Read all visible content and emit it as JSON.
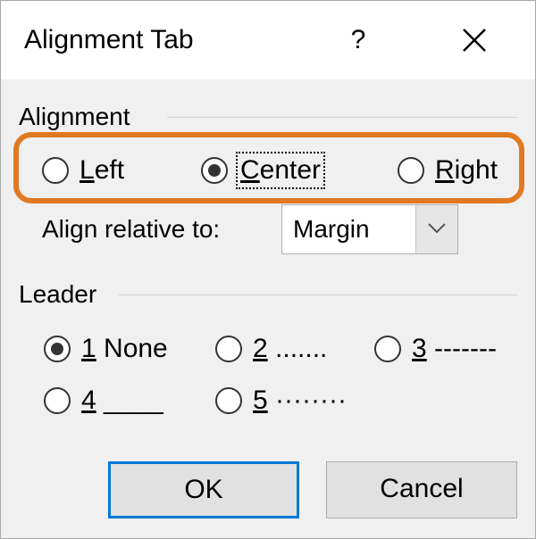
{
  "dialog": {
    "title": "Alignment Tab",
    "help_label": "?"
  },
  "alignment": {
    "group_label": "Alignment",
    "options": [
      {
        "mnemonic": "L",
        "rest": "eft",
        "checked": false
      },
      {
        "mnemonic": "C",
        "rest": "enter",
        "checked": true
      },
      {
        "mnemonic": "R",
        "rest": "ight",
        "checked": false
      }
    ],
    "relative_label": "Align relative to:",
    "relative_value": "Margin",
    "highlight_color": "#e07a22"
  },
  "leader": {
    "group_label": "Leader",
    "options": [
      {
        "mnemonic": "1",
        "rest": " None",
        "checked": true
      },
      {
        "mnemonic": "2",
        "rest": " .......",
        "checked": false
      },
      {
        "mnemonic": "3",
        "rest": " -------",
        "checked": false
      },
      {
        "mnemonic": "4",
        "rest": " ____",
        "checked": false
      },
      {
        "mnemonic": "5",
        "rest": " ········",
        "checked": false
      }
    ]
  },
  "buttons": {
    "ok": "OK",
    "cancel": "Cancel",
    "default_border_color": "#0078d7"
  }
}
